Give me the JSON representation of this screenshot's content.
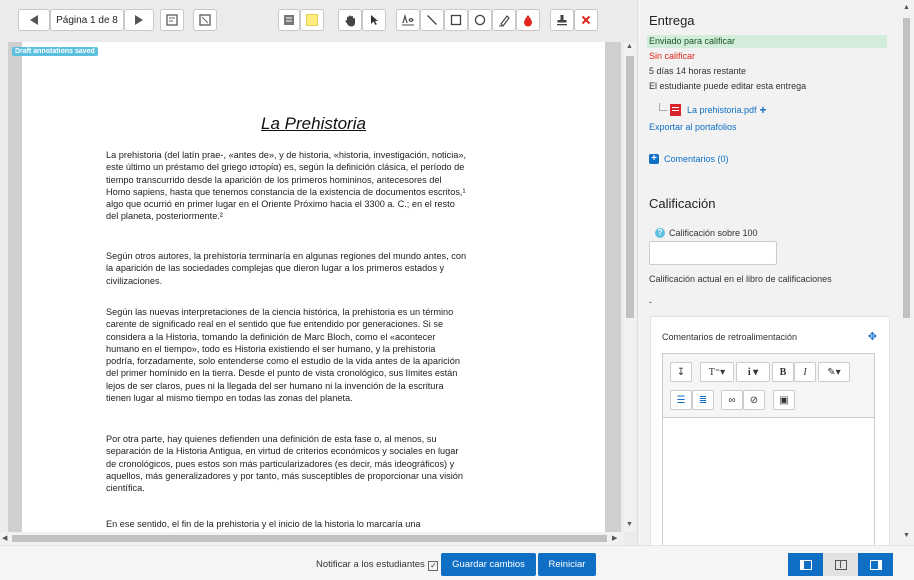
{
  "pdf_toolbar": {
    "page_label": "Página 1 de 8"
  },
  "document": {
    "badge": "Draft annotations saved",
    "title": "La Prehistoria",
    "paragraphs": [
      [
        "La prehistoria (del latín prae-, «antes de», y de historia, «historia, investigación, noticia»,",
        "este último un préstamo del griego ιστορία) es, según la definición clásica, el período de",
        "tiempo transcurrido desde la aparición de los primeros homininos, antecesores del",
        "Homo sapiens, hasta que tenemos constancia de la existencia de documentos escritos,¹",
        "algo que ocurrió en primer lugar en el Oriente Próximo hacia el 3300 a. C.; en el resto",
        "del planeta, posteriormente.²"
      ],
      [
        "Según otros autores, la prehistoria terminaría en algunas regiones del mundo antes, con",
        "la aparición de las sociedades complejas que dieron lugar a los primeros estados y",
        "civilizaciones."
      ],
      [
        "Según las nuevas interpretaciones de la ciencia histórica, la prehistoria es un término",
        "carente de significado real en el sentido que fue entendido por generaciones. Si se",
        "considera a la Historia, tomando la definición de Marc Bloch, como el «acontecer",
        "humano en el tiempo», todo es Historia existiendo el ser humano, y la prehistoria",
        "podría, forzadamente, solo entenderse como el estudio de la vida antes de la aparición",
        "del primer homínido en la tierra. Desde el punto de vista cronológico, sus límites están",
        "lejos de ser claros, pues ni la llegada del ser humano ni la invención de la escritura",
        "tienen lugar al mismo tiempo en todas las zonas del planeta."
      ],
      [
        "Por otra parte, hay quienes defienden una definición de esta fase o, al menos, su",
        "separación de la Historia Antigua, en virtud de criterios económicos y sociales en lugar",
        "de cronológicos, pues estos son más particularizadores (es decir, más ideográficos) y",
        "aquellos, más generalizadores y por tanto, más susceptibles de proporcionar una visión",
        "científica."
      ],
      [
        "En ese sentido, el fin de la prehistoria y el inicio de la historia lo marcaría una"
      ]
    ]
  },
  "bottom_bar": {
    "notify_label": "Notificar a los estudiantes",
    "save_label": "Guardar cambios",
    "reset_label": "Reiniciar"
  },
  "panel": {
    "section_title": "Entrega",
    "status_submitted": "Enviado para calificar",
    "status_grade": "Sin calificar",
    "time_remaining": "5 días 14 horas restante",
    "edit_note": "El estudiante puede editar esta entrega",
    "file_name": "La prehistoria.pdf",
    "export_link": "Exportar al portafolios",
    "comments_link": "Comentarios (0)",
    "grade_title": "Calificación",
    "grade_label": "Calificación sobre 100",
    "grade_value": "",
    "current_grade_label": "Calificación actual en el libro de calificaciones",
    "current_grade_value": "-",
    "feedback_title": "Comentarios de retroalimentación"
  },
  "colors": {
    "accent": "#0f6fc5",
    "status_green_bg": "#d4edda",
    "error_red": "#e0261f",
    "pdf_icon_red": "#d9232d"
  }
}
